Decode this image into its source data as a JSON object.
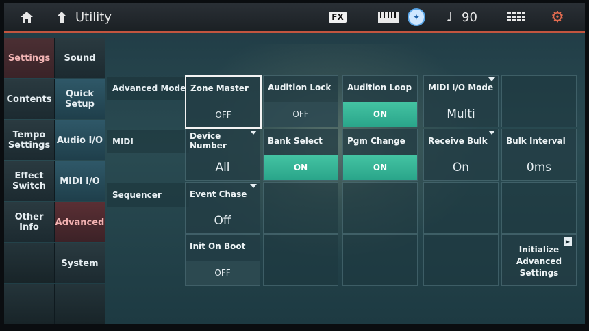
{
  "topbar": {
    "title": "Utility",
    "fx_label": "FX",
    "tempo": "90"
  },
  "tabs_col1": [
    "Settings",
    "Contents",
    "Tempo Settings",
    "Effect Switch",
    "Other Info"
  ],
  "tabs_col2": [
    "Sound",
    "Quick Setup",
    "Audio I/O",
    "MIDI I/O",
    "Advanced",
    "System"
  ],
  "row_labels": {
    "advanced_mode": "Advanced Mode",
    "midi": "MIDI",
    "sequencer": "Sequencer"
  },
  "advanced_mode": {
    "zone_master": {
      "label": "Zone Master",
      "value": "OFF"
    },
    "audition_lock": {
      "label": "Audition Lock",
      "value": "OFF"
    },
    "audition_loop": {
      "label": "Audition Loop",
      "value": "ON"
    },
    "midi_io_mode": {
      "label": "MIDI I/O Mode",
      "value": "Multi"
    }
  },
  "midi": {
    "device_number": {
      "label": "Device Number",
      "value": "All"
    },
    "bank_select": {
      "label": "Bank Select",
      "value": "ON"
    },
    "pgm_change": {
      "label": "Pgm Change",
      "value": "ON"
    },
    "receive_bulk": {
      "label": "Receive Bulk",
      "value": "On"
    },
    "bulk_interval": {
      "label": "Bulk Interval",
      "value": "0ms"
    }
  },
  "sequencer": {
    "event_chase": {
      "label": "Event Chase",
      "value": "Off"
    },
    "init_on_boot": {
      "label": "Init On Boot",
      "value": "OFF"
    }
  },
  "initialize": {
    "label": "Initialize Advanced Settings"
  },
  "colors": {
    "accent": "#c2553f",
    "on_green": "#35b796",
    "active_tab": "#f1b3b3"
  }
}
